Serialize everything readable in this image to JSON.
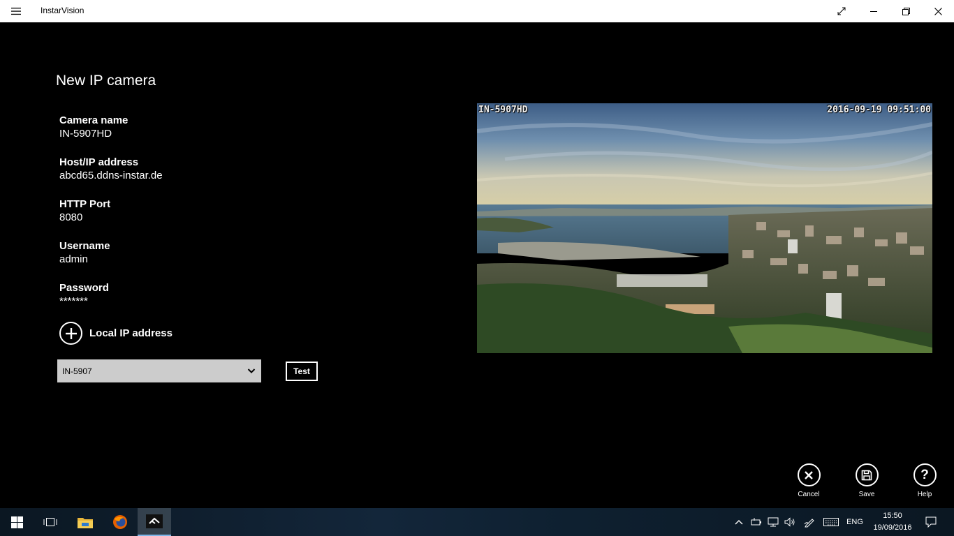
{
  "titlebar": {
    "app_name": "InstarVision",
    "icons": [
      "hamburger-menu-icon",
      "fullscreen-icon",
      "minimize-icon",
      "restore-icon",
      "close-icon"
    ]
  },
  "page": {
    "title": "New IP camera"
  },
  "form": {
    "camera_name_label": "Camera name",
    "camera_name_value": "IN-5907HD",
    "host_label": "Host/IP address",
    "host_value": "abcd65.ddns-instar.de",
    "port_label": "HTTP Port",
    "port_value": "8080",
    "username_label": "Username",
    "username_value": "admin",
    "password_label": "Password",
    "password_value": "*******",
    "local_ip_label": "Local IP address",
    "model_selected": "IN-5907",
    "test_label": "Test"
  },
  "preview": {
    "osd_name": "IN-5907HD",
    "osd_timestamp": "2016-09-19 09:51:00"
  },
  "appbar": {
    "cancel_label": "Cancel",
    "save_label": "Save",
    "help_label": "Help"
  },
  "taskbar": {
    "language": "ENG",
    "time": "15:50",
    "date": "19/09/2016",
    "accent_color": "#7fb6e8"
  }
}
